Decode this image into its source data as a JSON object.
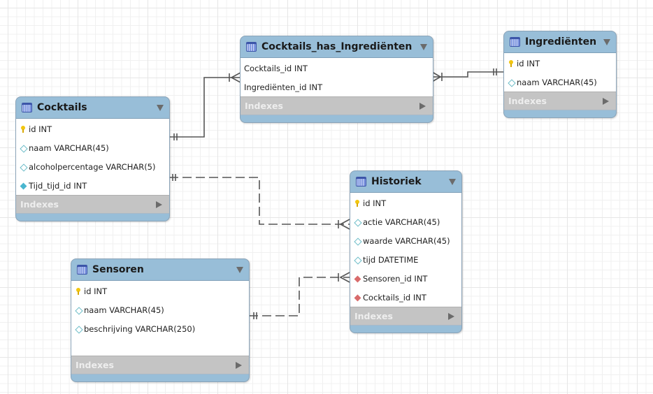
{
  "diagram": {
    "type": "EER diagram",
    "colors": {
      "header": "#98bed8",
      "indexes_bar": "#c4c4c4",
      "connector": "#555555",
      "pk_key": "#f2c60f",
      "fk_red": "#d96b6b",
      "fk_teal": "#4ab6cf"
    }
  },
  "tables": {
    "cocktails_has": {
      "title": "Cocktails_has_Ingrediënten",
      "columns": [
        {
          "text": "Cocktails_id INT",
          "icon": "none"
        },
        {
          "text": "Ingrediënten_id INT",
          "icon": "none"
        }
      ],
      "indexes_label": "Indexes"
    },
    "ingredienten": {
      "title": "Ingrediënten",
      "columns": [
        {
          "text": "id INT",
          "icon": "primary-key-icon"
        },
        {
          "text": "naam VARCHAR(45)",
          "icon": "column-diamond-icon"
        }
      ],
      "indexes_label": "Indexes"
    },
    "cocktails": {
      "title": "Cocktails",
      "columns": [
        {
          "text": "id INT",
          "icon": "primary-key-icon"
        },
        {
          "text": "naam VARCHAR(45)",
          "icon": "column-diamond-icon"
        },
        {
          "text": "alcoholpercentage VARCHAR(5)",
          "icon": "column-diamond-icon"
        },
        {
          "text": "Tijd_tijd_id INT",
          "icon": "foreign-key-diamond-icon"
        }
      ],
      "indexes_label": "Indexes"
    },
    "historiek": {
      "title": "Historiek",
      "columns": [
        {
          "text": "id INT",
          "icon": "primary-key-icon"
        },
        {
          "text": "actie VARCHAR(45)",
          "icon": "column-diamond-icon"
        },
        {
          "text": "waarde VARCHAR(45)",
          "icon": "column-diamond-icon"
        },
        {
          "text": "tijd DATETIME",
          "icon": "column-diamond-icon"
        },
        {
          "text": "Sensoren_id INT",
          "icon": "foreign-key-red-icon"
        },
        {
          "text": "Cocktails_id INT",
          "icon": "foreign-key-red-icon"
        }
      ],
      "indexes_label": "Indexes"
    },
    "sensoren": {
      "title": "Sensoren",
      "columns": [
        {
          "text": "id INT",
          "icon": "primary-key-icon"
        },
        {
          "text": "naam VARCHAR(45)",
          "icon": "column-diamond-icon"
        },
        {
          "text": "beschrijving VARCHAR(250)",
          "icon": "column-diamond-icon"
        }
      ],
      "indexes_label": "Indexes"
    }
  },
  "relationships": [
    {
      "from": "Cocktails",
      "to": "Cocktails_has_Ingrediënten",
      "from_cardinality": "one-and-only-one",
      "to_cardinality": "one-or-many",
      "identifying": true
    },
    {
      "from": "Ingrediënten",
      "to": "Cocktails_has_Ingrediënten",
      "from_cardinality": "one-and-only-one",
      "to_cardinality": "one-or-many",
      "identifying": true
    },
    {
      "from": "Cocktails",
      "to": "Historiek",
      "from_cardinality": "one-and-only-one",
      "to_cardinality": "one-or-many",
      "identifying": false
    },
    {
      "from": "Sensoren",
      "to": "Historiek",
      "from_cardinality": "one-and-only-one",
      "to_cardinality": "one-or-many",
      "identifying": false
    }
  ]
}
